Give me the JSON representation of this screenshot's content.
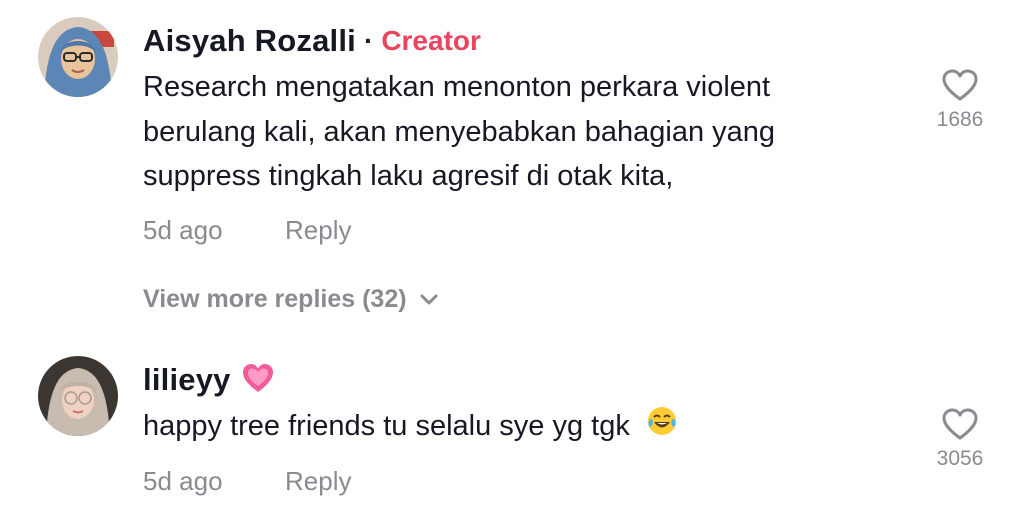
{
  "comments": [
    {
      "username": "Aisyah Rozalli",
      "separator": "·",
      "badge": "Creator",
      "text_lines": [
        "Research mengatakan menonton perkara violent",
        "berulang kali, akan menyebabkan bahagian yang",
        "suppress tingkah laku agresif di otak kita,"
      ],
      "time": "5d ago",
      "reply_label": "Reply",
      "likes": "1686",
      "avatar_icon": "avatar-hijab-glasses"
    },
    {
      "username": "lilieyy",
      "username_emoji": "pink-heart-emoji",
      "text": "happy tree friends tu selalu sye yg tgk",
      "text_emoji": "tears-of-joy-emoji",
      "time": "5d ago",
      "reply_label": "Reply",
      "likes": "3056",
      "avatar_icon": "avatar-hijab-glasses"
    }
  ],
  "view_more": {
    "label": "View more replies (32)",
    "icon": "chevron-down-icon"
  },
  "colors": {
    "primary_text": "#161823",
    "secondary_text": "#8a8b91",
    "creator_badge": "#e8455f"
  }
}
